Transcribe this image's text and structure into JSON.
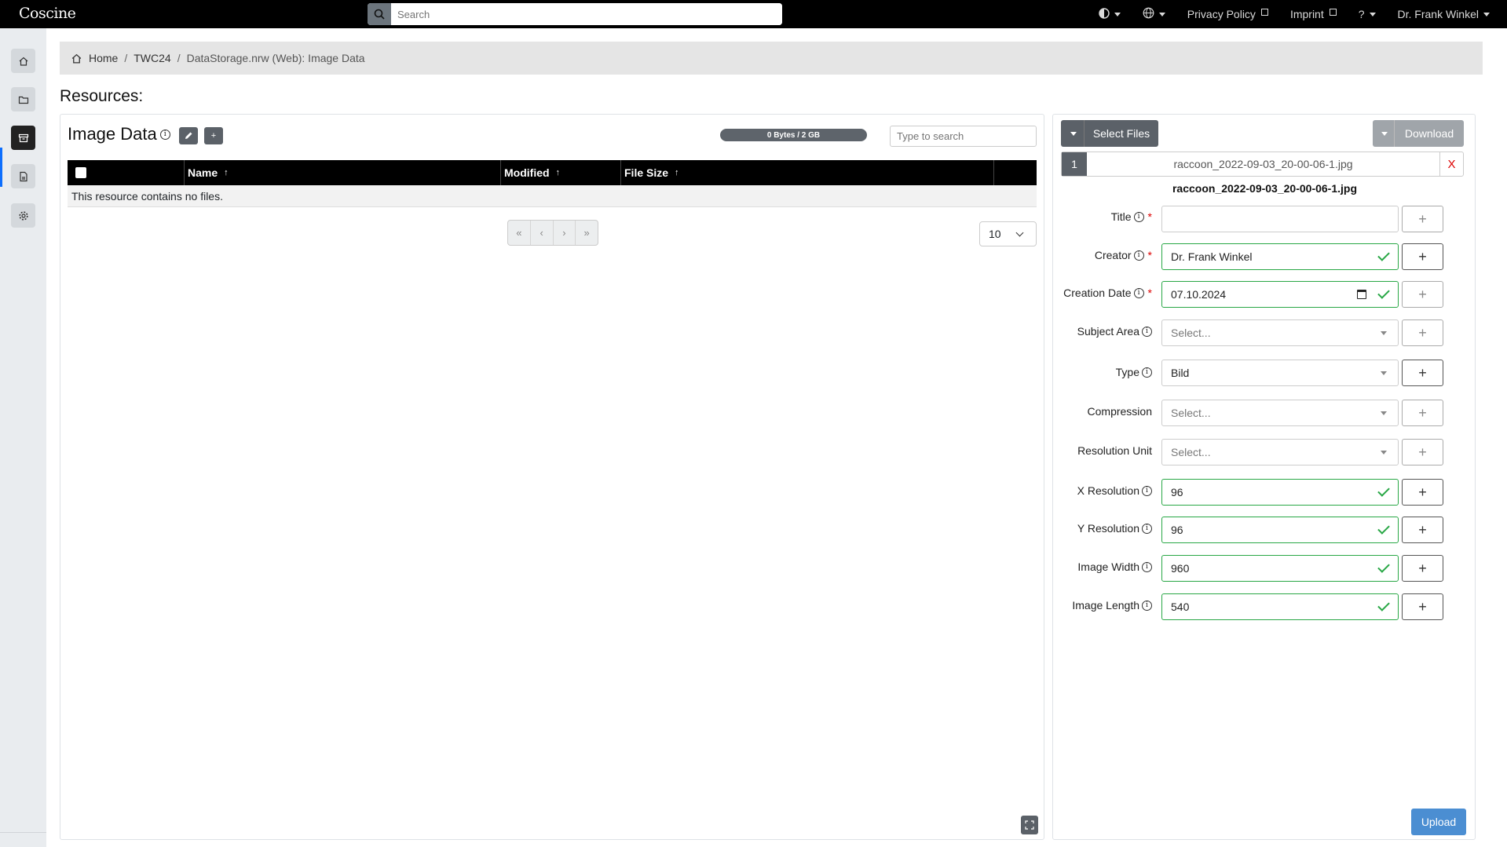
{
  "app": {
    "logo": "Coscine"
  },
  "topbar": {
    "search_placeholder": "Search",
    "privacy": "Privacy Policy",
    "imprint": "Imprint",
    "help": "?",
    "user": "Dr. Frank Winkel"
  },
  "sidebar": {
    "items": [
      {
        "name": "home-icon"
      },
      {
        "name": "folder-icon"
      },
      {
        "name": "archive-icon"
      },
      {
        "name": "document-icon"
      },
      {
        "name": "gear-icon"
      }
    ]
  },
  "breadcrumb": {
    "home": "Home",
    "project": "TWC24",
    "current": "DataStorage.nrw (Web): Image Data"
  },
  "page_title": "Resources:",
  "resource": {
    "title": "Image Data",
    "quota": "0 Bytes / 2 GB",
    "search_placeholder": "Type to search",
    "columns": {
      "name": "Name",
      "modified": "Modified",
      "size": "File Size"
    },
    "empty_text": "This resource contains no files.",
    "pager": {
      "first": "«",
      "prev": "‹",
      "next": "›",
      "last": "»"
    },
    "per_page": "10"
  },
  "upload": {
    "select_files": "Select Files",
    "download": "Download",
    "file_index": "1",
    "file_name": "raccoon_2022-09-03_20-00-06-1.jpg",
    "remove": "X",
    "heading": "raccoon_2022-09-03_20-00-06-1.jpg",
    "upload_label": "Upload",
    "fields": {
      "title": {
        "label": "Title",
        "value": ""
      },
      "creator": {
        "label": "Creator",
        "value": "Dr. Frank Winkel"
      },
      "creation_date": {
        "label": "Creation Date",
        "value": "07.10.2024"
      },
      "subject_area": {
        "label": "Subject Area",
        "value": "Select..."
      },
      "type": {
        "label": "Type",
        "value": "Bild"
      },
      "compression": {
        "label": "Compression",
        "value": "Select..."
      },
      "resolution_unit": {
        "label": "Resolution Unit",
        "value": "Select..."
      },
      "x_resolution": {
        "label": "X Resolution",
        "value": "96"
      },
      "y_resolution": {
        "label": "Y Resolution",
        "value": "96"
      },
      "image_width": {
        "label": "Image Width",
        "value": "960"
      },
      "image_length": {
        "label": "Image Length",
        "value": "540"
      }
    }
  },
  "colors": {
    "accent": "#0d6efd",
    "valid": "#28a745",
    "upload": "#4b8ed2",
    "remove": "#dd0000"
  }
}
